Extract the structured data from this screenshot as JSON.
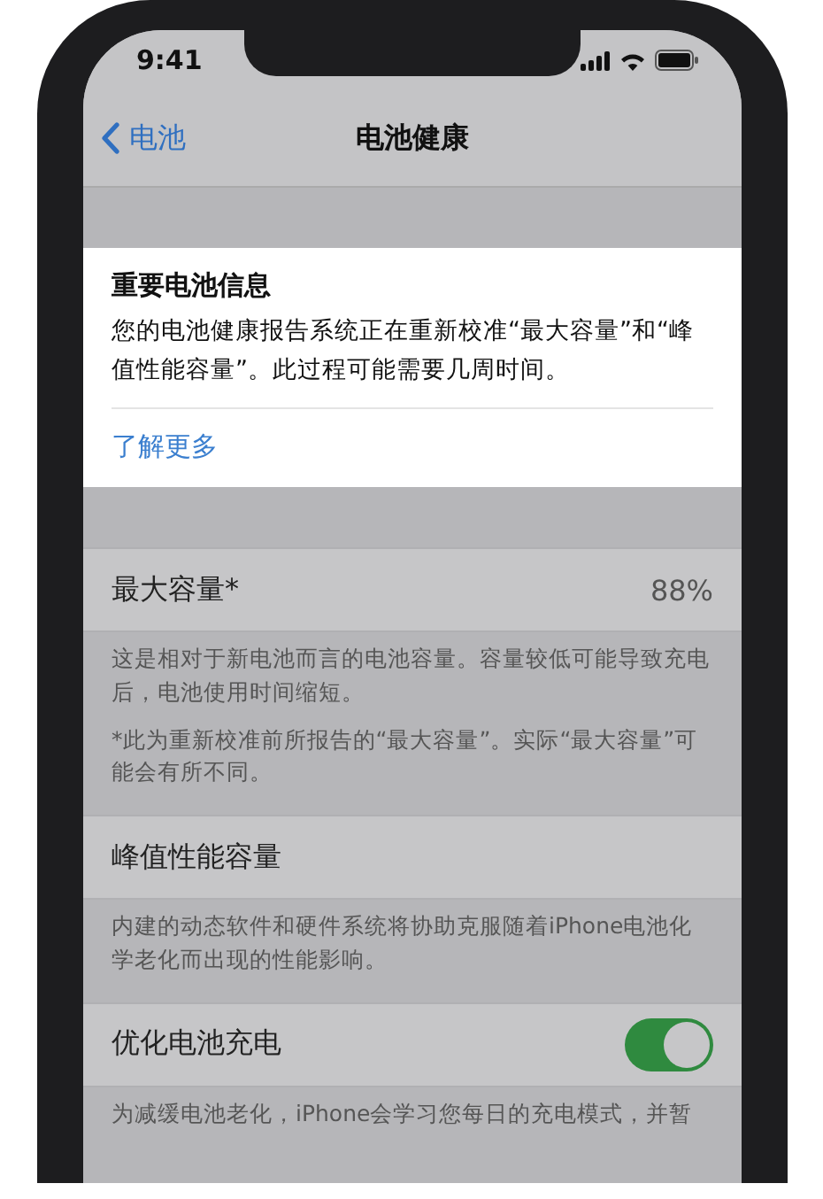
{
  "status_bar": {
    "time": "9:41"
  },
  "nav": {
    "back_label": "电池",
    "title": "电池健康"
  },
  "notice": {
    "title": "重要电池信息",
    "body": "您的电池健康报告系统正在重新校准“最大容量”和“峰值性能容量”。此过程可能需要几周时间。",
    "link": "了解更多"
  },
  "sections": [
    {
      "kind": "value",
      "label": "最大容量*",
      "value": "88%",
      "footers": [
        "这是相对于新电池而言的电池容量。容量较低可能导致充电后，电池使用时间缩短。",
        "*此为重新校准前所报告的“最大容量”。实际“最大容量”可能会有所不同。"
      ]
    },
    {
      "kind": "plain",
      "label": "峰值性能容量",
      "footers": [
        "内建的动态软件和硬件系统将协助克服随着iPhone电池化学老化而出现的性能影响。"
      ]
    },
    {
      "kind": "toggle",
      "label": "优化电池充电",
      "on": true,
      "footers": [
        "为减缓电池老化，iPhone会学习您每日的充电模式，并暂"
      ]
    }
  ]
}
